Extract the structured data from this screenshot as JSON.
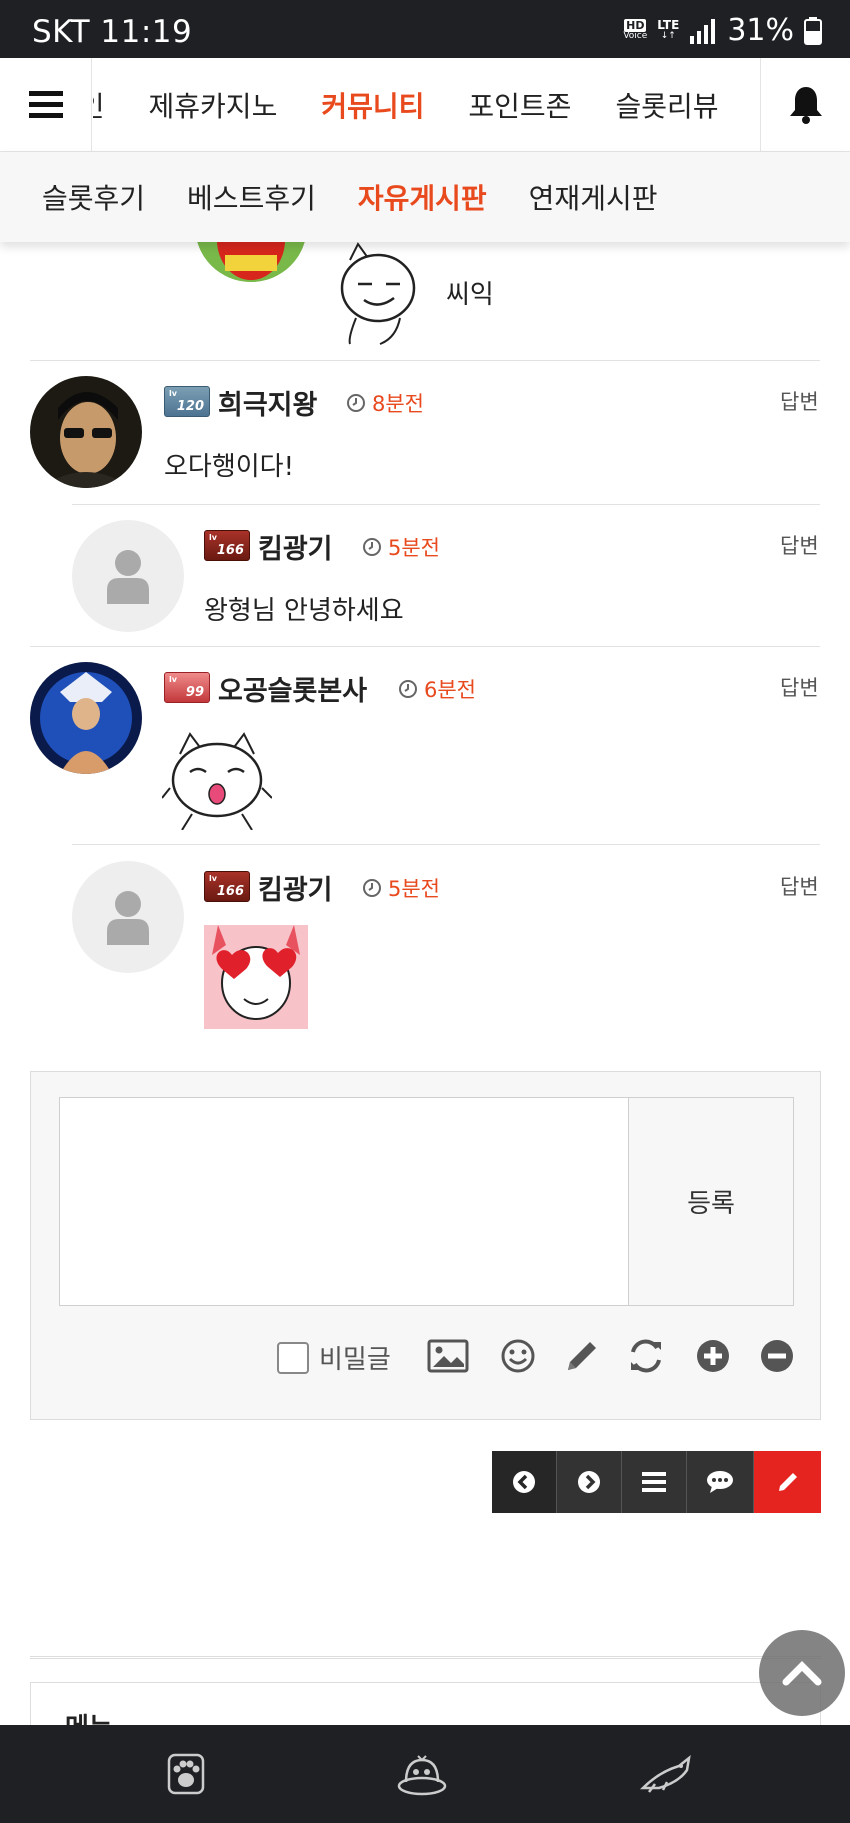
{
  "status_bar": {
    "carrier_time": "SKT 11:19",
    "hd_label": "HD",
    "voice_label": "Voice",
    "network": "LTE",
    "battery": "31%"
  },
  "main_nav": {
    "menu_icon": "hamburger-icon",
    "items": [
      {
        "label": "메인",
        "active": false
      },
      {
        "label": "제휴카지노",
        "active": false
      },
      {
        "label": "커뮤니티",
        "active": true
      },
      {
        "label": "포인트존",
        "active": false
      },
      {
        "label": "슬롯리뷰",
        "active": false
      }
    ],
    "bell_icon": "bell-icon",
    "active_color": "#e8491d"
  },
  "sub_nav": {
    "items": [
      {
        "label": "슬롯후기",
        "active": false
      },
      {
        "label": "베스트후기",
        "active": false
      },
      {
        "label": "자유게시판",
        "active": true
      },
      {
        "label": "연재게시판",
        "active": false
      }
    ]
  },
  "comments": {
    "prev_comment_text": "씨익",
    "reply_label": "답변",
    "items": [
      {
        "nick": "희극지왕",
        "level": "120",
        "time": "8분전",
        "text": "오다행이다!",
        "is_reply": false
      },
      {
        "nick": "킴광기",
        "level": "166",
        "time": "5분전",
        "text": "왕형님 안녕하세요",
        "is_reply": true
      },
      {
        "nick": "오공슬롯본사",
        "level": "99",
        "time": "6분전",
        "text": "",
        "is_reply": false
      },
      {
        "nick": "킴광기",
        "level": "166",
        "time": "5분전",
        "text": "",
        "is_reply": true
      }
    ],
    "level_prefix": "lv"
  },
  "write_box": {
    "submit_label": "등록",
    "secret_label": "비밀글",
    "tools": [
      "image-icon",
      "smile-icon",
      "pencil-icon",
      "refresh-icon",
      "plus-circle-icon",
      "minus-circle-icon"
    ]
  },
  "action_bar": {
    "buttons": [
      "prev-icon",
      "next-icon",
      "list-icon",
      "comment-icon",
      "write-icon"
    ],
    "write_color": "#e5231f"
  },
  "footer": {
    "menu_title": "메뉴"
  },
  "bottom_bar": {
    "items": [
      "paw-icon",
      "slot-machine-icon",
      "cat-icon"
    ]
  }
}
